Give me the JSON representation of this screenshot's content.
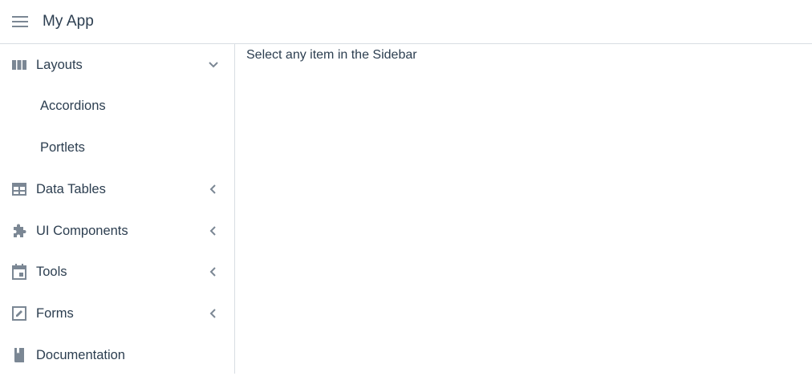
{
  "header": {
    "menu_icon": "hamburger-menu-icon",
    "title": "My App"
  },
  "sidebar": {
    "items": [
      {
        "label": "Layouts",
        "icon": "columns-icon",
        "chevron": "chevron-down-icon",
        "expanded": true,
        "children": [
          {
            "label": "Accordions"
          },
          {
            "label": "Portlets"
          }
        ]
      },
      {
        "label": "Data Tables",
        "icon": "table-icon",
        "chevron": "chevron-left-icon"
      },
      {
        "label": "UI Components",
        "icon": "puzzle-icon",
        "chevron": "chevron-left-icon"
      },
      {
        "label": "Tools",
        "icon": "calendar-icon",
        "chevron": "chevron-left-icon"
      },
      {
        "label": "Forms",
        "icon": "edit-box-icon",
        "chevron": "chevron-left-icon"
      },
      {
        "label": "Documentation",
        "icon": "book-icon"
      }
    ]
  },
  "main": {
    "message": "Select any item in the Sidebar"
  },
  "colors": {
    "text": "#2c3e50",
    "icon": "#7b8794",
    "border": "#d8dde3"
  }
}
